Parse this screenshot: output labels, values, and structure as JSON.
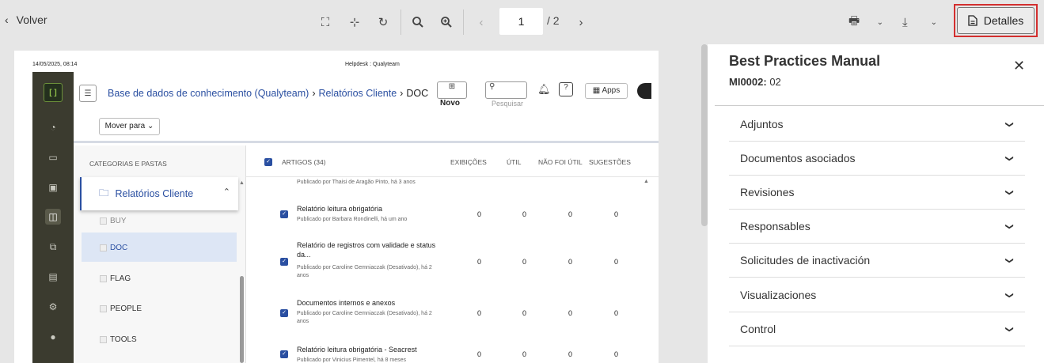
{
  "toolbar": {
    "back_label": "Volver",
    "page_current": "1",
    "page_total": "/ 2",
    "details_label": "Detalles"
  },
  "document": {
    "date": "14/05/2025, 08:14",
    "header": "Helpdesk : Qualyteam",
    "breadcrumb": {
      "root": "Base de dados de conhecimento (Qualyteam)",
      "folder": "Relatórios Cliente",
      "current": "DOC"
    },
    "novo_label": "Novo",
    "search_label": "Pesquisar",
    "apps_label": "Apps",
    "mover_label": "Mover para",
    "categories": {
      "title": "CATEGORIAS E PASTAS",
      "active": "Relatórios Cliente",
      "items": [
        "BUY",
        "DOC",
        "FLAG",
        "PEOPLE",
        "TOOLS"
      ]
    },
    "articles": {
      "header": "ARTIGOS (34)",
      "columns": [
        "EXIBIÇÕES",
        "ÚTIL",
        "NÃO FOI ÚTIL",
        "SUGESTÕES"
      ],
      "top_partial": "Publicado por Thaisi de Aragão Pinto, há 3 anos",
      "rows": [
        {
          "title": "Relatório leitura obrigatória",
          "sub": "Publicado por Barbara Rondinelli, há um ano",
          "views": "0",
          "useful": "0",
          "not_useful": "0",
          "suggestions": "0"
        },
        {
          "title": "Relatório de registros com validade e status da...",
          "sub": "Publicado por Caroline Gemniaczak (Desativado), há 2 anos",
          "views": "0",
          "useful": "0",
          "not_useful": "0",
          "suggestions": "0"
        },
        {
          "title": "Documentos internos e anexos",
          "sub": "Publicado por Caroline Gemniaczak (Desativado), há 2 anos",
          "views": "0",
          "useful": "0",
          "not_useful": "0",
          "suggestions": "0"
        },
        {
          "title": "Relatório leitura obrigatória - Seacrest",
          "sub": "Publicado por Vinicius Pimentel, há 8 meses",
          "views": "0",
          "useful": "0",
          "not_useful": "0",
          "suggestions": "0"
        }
      ]
    }
  },
  "details": {
    "title": "Best Practices Manual",
    "code_label": "MI0002:",
    "code_value": "02",
    "sections": [
      "Adjuntos",
      "Documentos asociados",
      "Revisiones",
      "Responsables",
      "Solicitudes de inactivación",
      "Visualizaciones",
      "Control"
    ]
  },
  "colors": {
    "highlight": "#d32f2f",
    "link": "#2a4fa1",
    "app_sidebar": "#3b3b2f"
  }
}
